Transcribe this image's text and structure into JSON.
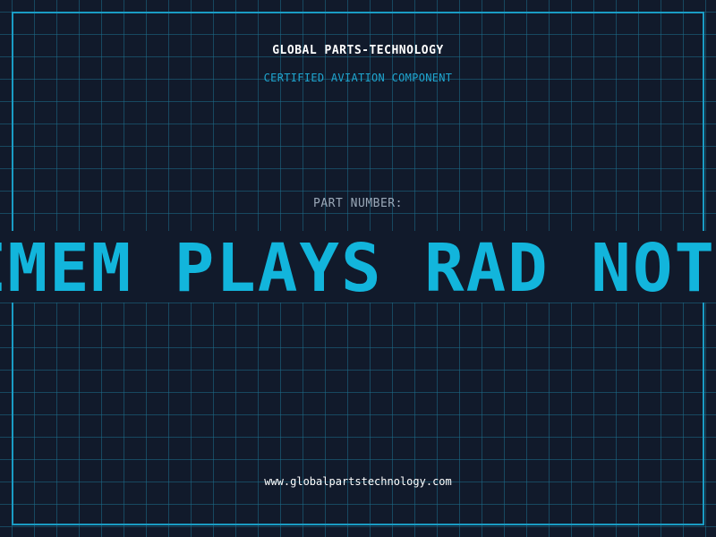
{
  "header": {
    "company": "GLOBAL PARTS-TECHNOLOGY",
    "subtitle": "CERTIFIED AVIATION COMPONENT"
  },
  "part": {
    "label": "PART NUMBER:",
    "value": "EMEM PLAYS RAD NOT"
  },
  "footer": {
    "url": "www.globalpartstechnology.com"
  },
  "colors": {
    "background": "#111a2b",
    "grid": "#1c6e8c",
    "accent": "#12b5dc",
    "frame": "#1a9cc4"
  }
}
